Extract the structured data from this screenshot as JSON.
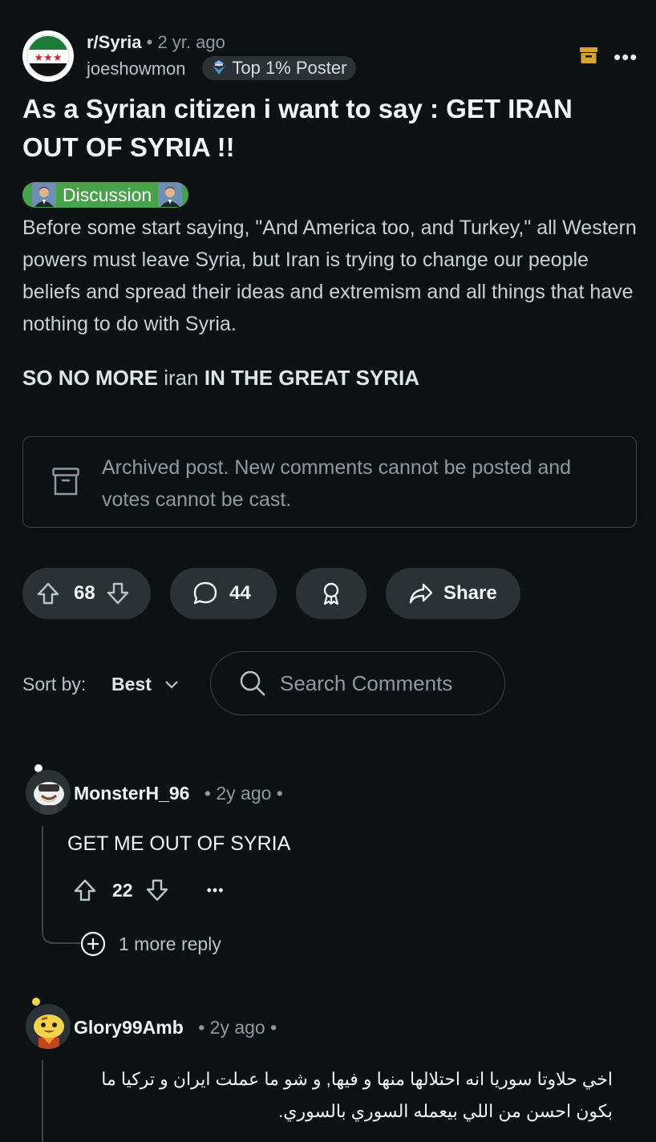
{
  "post": {
    "subreddit": "r/Syria",
    "separator": "•",
    "time": "2 yr. ago",
    "author": "joeshowmon",
    "badge": "Top 1% Poster",
    "title": "As a Syrian citizen i want to say : GET IRAN OUT OF SYRIA !!",
    "flair": "Discussion",
    "body": "Before some start saying, \"And America too, and Turkey,\" all Western powers must leave Syria, but Iran is trying to change our people beliefs and spread their ideas and extremism and all things that have nothing to do with Syria.",
    "shout_a": "SO NO MORE",
    "shout_b": "iran",
    "shout_c": "IN THE GREAT SYRIA",
    "archived_notice": "Archived post. New comments cannot be posted and votes cannot be cast.",
    "votes": "68",
    "comments": "44",
    "share_label": "Share"
  },
  "sort": {
    "label": "Sort by:",
    "value": "Best"
  },
  "search": {
    "placeholder": "Search Comments"
  },
  "comments": [
    {
      "author": "MonsterH_96",
      "time": "2y ago",
      "text": "GET ME OUT OF SYRIA",
      "votes": "22",
      "more_replies": "1 more reply"
    },
    {
      "author": "Glory99Amb",
      "time": "2y ago",
      "text": "اخي حلاوتا سوريا انه احتلالها منها و فيها, و شو ما عملت ايران و تركيا ما بكون احسن من اللي بيعمله السوري بالسوري."
    }
  ],
  "colors": {
    "background": "#0e1113",
    "pill": "#2a3236",
    "flair": "#46a34a",
    "archive_icon": "#d4a72c"
  },
  "icons": [
    "syria-flag-icon",
    "archive-box-icon",
    "more-icon",
    "badge-icon",
    "upvote-icon",
    "downvote-icon",
    "comment-icon",
    "award-icon",
    "share-icon",
    "chevron-down-icon",
    "search-icon",
    "add-reply-icon"
  ]
}
